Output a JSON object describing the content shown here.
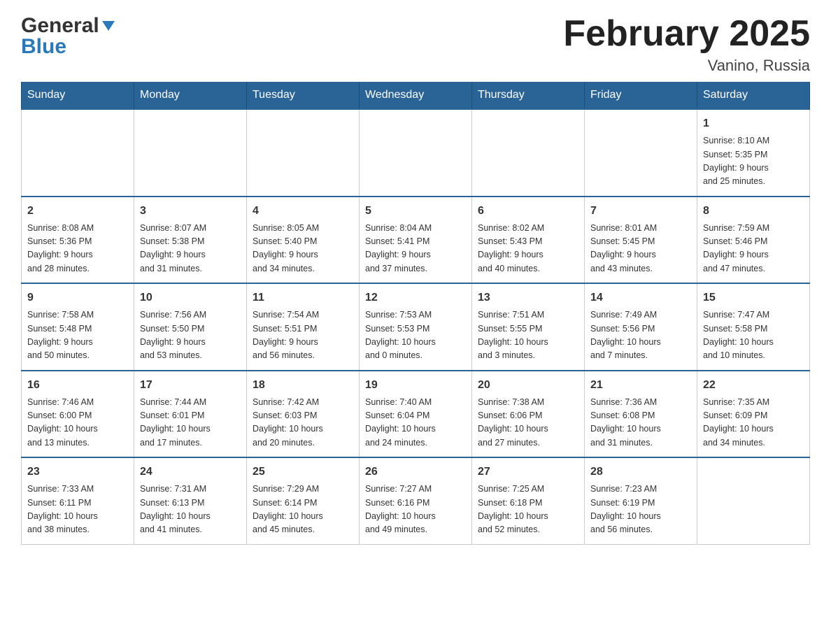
{
  "header": {
    "logo_general": "General",
    "logo_blue": "Blue",
    "title": "February 2025",
    "location": "Vanino, Russia"
  },
  "weekdays": [
    "Sunday",
    "Monday",
    "Tuesday",
    "Wednesday",
    "Thursday",
    "Friday",
    "Saturday"
  ],
  "weeks": [
    [
      {
        "day": "",
        "info": ""
      },
      {
        "day": "",
        "info": ""
      },
      {
        "day": "",
        "info": ""
      },
      {
        "day": "",
        "info": ""
      },
      {
        "day": "",
        "info": ""
      },
      {
        "day": "",
        "info": ""
      },
      {
        "day": "1",
        "info": "Sunrise: 8:10 AM\nSunset: 5:35 PM\nDaylight: 9 hours\nand 25 minutes."
      }
    ],
    [
      {
        "day": "2",
        "info": "Sunrise: 8:08 AM\nSunset: 5:36 PM\nDaylight: 9 hours\nand 28 minutes."
      },
      {
        "day": "3",
        "info": "Sunrise: 8:07 AM\nSunset: 5:38 PM\nDaylight: 9 hours\nand 31 minutes."
      },
      {
        "day": "4",
        "info": "Sunrise: 8:05 AM\nSunset: 5:40 PM\nDaylight: 9 hours\nand 34 minutes."
      },
      {
        "day": "5",
        "info": "Sunrise: 8:04 AM\nSunset: 5:41 PM\nDaylight: 9 hours\nand 37 minutes."
      },
      {
        "day": "6",
        "info": "Sunrise: 8:02 AM\nSunset: 5:43 PM\nDaylight: 9 hours\nand 40 minutes."
      },
      {
        "day": "7",
        "info": "Sunrise: 8:01 AM\nSunset: 5:45 PM\nDaylight: 9 hours\nand 43 minutes."
      },
      {
        "day": "8",
        "info": "Sunrise: 7:59 AM\nSunset: 5:46 PM\nDaylight: 9 hours\nand 47 minutes."
      }
    ],
    [
      {
        "day": "9",
        "info": "Sunrise: 7:58 AM\nSunset: 5:48 PM\nDaylight: 9 hours\nand 50 minutes."
      },
      {
        "day": "10",
        "info": "Sunrise: 7:56 AM\nSunset: 5:50 PM\nDaylight: 9 hours\nand 53 minutes."
      },
      {
        "day": "11",
        "info": "Sunrise: 7:54 AM\nSunset: 5:51 PM\nDaylight: 9 hours\nand 56 minutes."
      },
      {
        "day": "12",
        "info": "Sunrise: 7:53 AM\nSunset: 5:53 PM\nDaylight: 10 hours\nand 0 minutes."
      },
      {
        "day": "13",
        "info": "Sunrise: 7:51 AM\nSunset: 5:55 PM\nDaylight: 10 hours\nand 3 minutes."
      },
      {
        "day": "14",
        "info": "Sunrise: 7:49 AM\nSunset: 5:56 PM\nDaylight: 10 hours\nand 7 minutes."
      },
      {
        "day": "15",
        "info": "Sunrise: 7:47 AM\nSunset: 5:58 PM\nDaylight: 10 hours\nand 10 minutes."
      }
    ],
    [
      {
        "day": "16",
        "info": "Sunrise: 7:46 AM\nSunset: 6:00 PM\nDaylight: 10 hours\nand 13 minutes."
      },
      {
        "day": "17",
        "info": "Sunrise: 7:44 AM\nSunset: 6:01 PM\nDaylight: 10 hours\nand 17 minutes."
      },
      {
        "day": "18",
        "info": "Sunrise: 7:42 AM\nSunset: 6:03 PM\nDaylight: 10 hours\nand 20 minutes."
      },
      {
        "day": "19",
        "info": "Sunrise: 7:40 AM\nSunset: 6:04 PM\nDaylight: 10 hours\nand 24 minutes."
      },
      {
        "day": "20",
        "info": "Sunrise: 7:38 AM\nSunset: 6:06 PM\nDaylight: 10 hours\nand 27 minutes."
      },
      {
        "day": "21",
        "info": "Sunrise: 7:36 AM\nSunset: 6:08 PM\nDaylight: 10 hours\nand 31 minutes."
      },
      {
        "day": "22",
        "info": "Sunrise: 7:35 AM\nSunset: 6:09 PM\nDaylight: 10 hours\nand 34 minutes."
      }
    ],
    [
      {
        "day": "23",
        "info": "Sunrise: 7:33 AM\nSunset: 6:11 PM\nDaylight: 10 hours\nand 38 minutes."
      },
      {
        "day": "24",
        "info": "Sunrise: 7:31 AM\nSunset: 6:13 PM\nDaylight: 10 hours\nand 41 minutes."
      },
      {
        "day": "25",
        "info": "Sunrise: 7:29 AM\nSunset: 6:14 PM\nDaylight: 10 hours\nand 45 minutes."
      },
      {
        "day": "26",
        "info": "Sunrise: 7:27 AM\nSunset: 6:16 PM\nDaylight: 10 hours\nand 49 minutes."
      },
      {
        "day": "27",
        "info": "Sunrise: 7:25 AM\nSunset: 6:18 PM\nDaylight: 10 hours\nand 52 minutes."
      },
      {
        "day": "28",
        "info": "Sunrise: 7:23 AM\nSunset: 6:19 PM\nDaylight: 10 hours\nand 56 minutes."
      },
      {
        "day": "",
        "info": ""
      }
    ]
  ]
}
